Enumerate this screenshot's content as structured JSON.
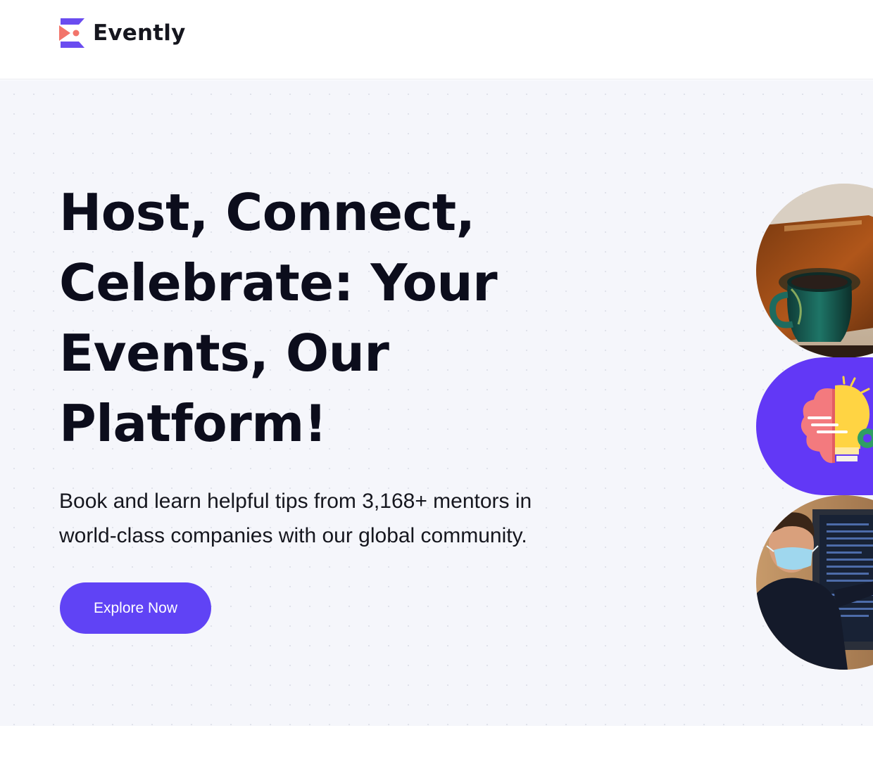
{
  "brand": {
    "name": "Evently",
    "colors": {
      "accent": "#6043F5",
      "logo_coral": "#F2756B",
      "logo_purple": "#6A4CF0"
    }
  },
  "hero": {
    "headline_lines": [
      "Host, Connect,",
      "Celebrate: Your",
      "Events, Our",
      "Platform!"
    ],
    "subtext_lines": [
      "Book and learn helpful tips from 3,168+ mentors in",
      "world-class companies with our global community."
    ],
    "cta_label": "Explore Now"
  },
  "images": [
    {
      "name": "mug-on-table-photo"
    },
    {
      "name": "brain-lightbulb-illustration"
    },
    {
      "name": "presenter-with-mask-photo"
    }
  ]
}
